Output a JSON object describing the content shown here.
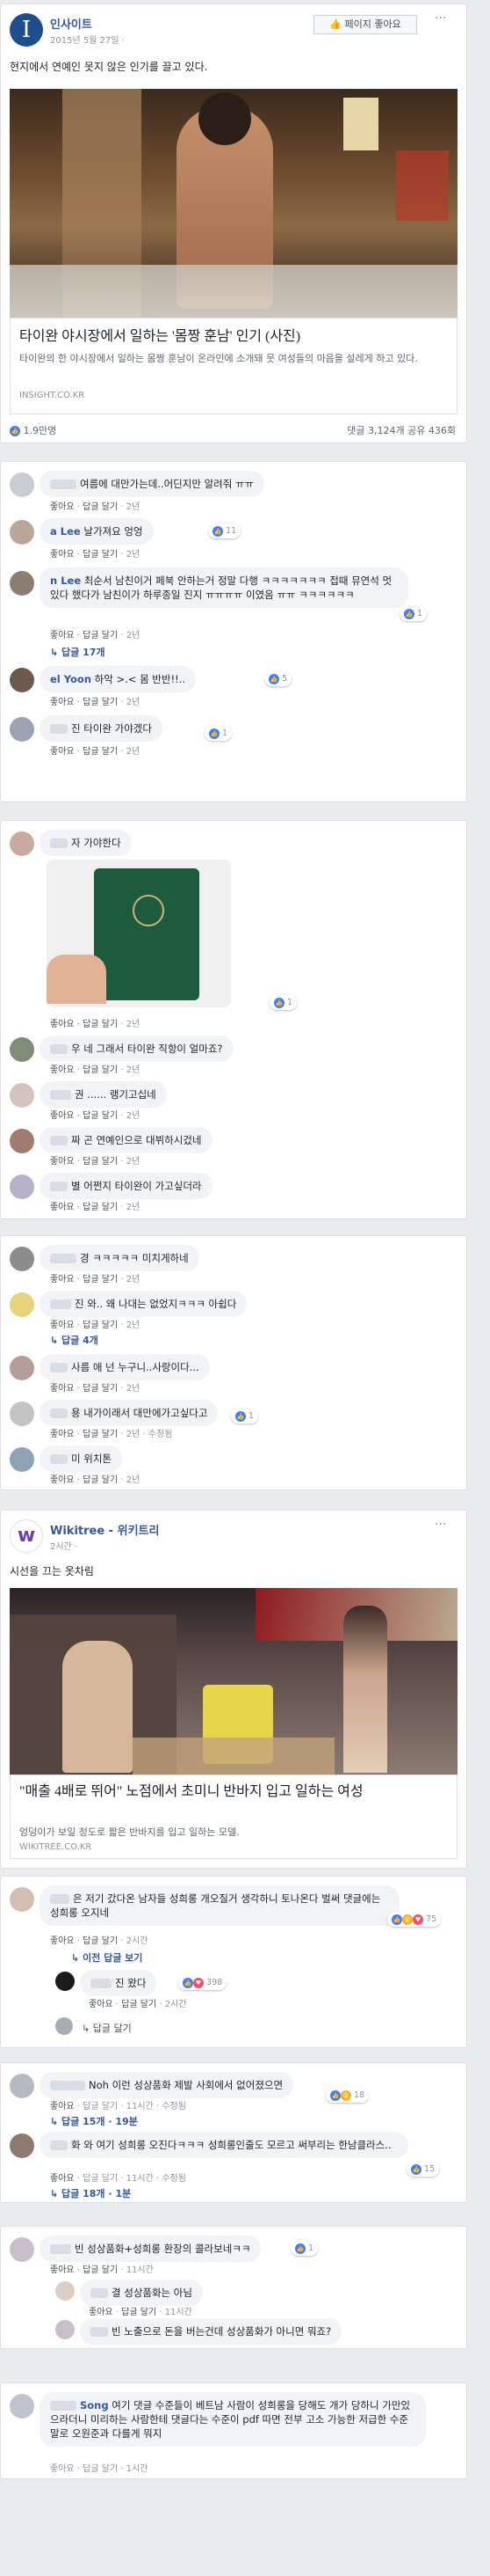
{
  "post1": {
    "page_name": "인사이트",
    "date": "2015년 5월 27일 ·",
    "like_page_button": "페이지 좋아요",
    "caption": "현지에서 연예인 못지 않은 인기를 끌고 있다.",
    "link_title": "타이완 야시장에서 일하는 '몸짱 훈남' 인기 (사진)",
    "link_desc": "타이완의 한 야시장에서 일하는 몸짱 훈남이 온라인에 소개돼 뭇 여성들의 마음을 설레게 하고 있다.",
    "link_domain": "INSIGHT.CO.KR",
    "reactions_count": "1.9만명",
    "comments_shares": "댓글 3,124개 공유 436회"
  },
  "thread1": [
    {
      "name": "",
      "text": "여름에 대만가는데..어딘지만 알려줘 ㅠㅠ",
      "reactions": ""
    },
    {
      "name": "a Lee",
      "text": "날가져요 엉엉",
      "reactions": "11"
    },
    {
      "name": "n Lee",
      "text": "최순서 남친이거 페북 안하는거 정말 다행 ㅋㅋㅋㅋㅋㅋㅋ 접때 뮤연석 멋있다 했다가 남친이가 하루종일 진지 ㅠㅠㅠㅠ 이였음 ㅠㅠ ㅋㅋㅋㅋㅋㅋ",
      "reactions": "1"
    },
    {
      "name": "el Yoon",
      "text": "하악 >.< 몸 반반!!..",
      "reactions": "5"
    },
    {
      "name": "",
      "text": "진 타이완 가야겠다",
      "reactions": "1"
    }
  ],
  "thread1_replies": "답글 17개",
  "thread2": {
    "top_text": "자 가야한다",
    "reactions_img": "1",
    "replies": [
      {
        "text": "우 네 그래서 타이완 직항이 얼마죠?"
      },
      {
        "text": "권 ...... 랭기고십네"
      },
      {
        "text": "짜 곤 연예인으로 대뷔하시겄네"
      },
      {
        "text": "별 어쩐지 타이완이 가고싶더라"
      }
    ]
  },
  "thread3": [
    {
      "text": "경 ㅋㅋㅋㅋㅋ 미치게하네"
    },
    {
      "text": "진 와.. 왜 나대는 없었지ㅋㅋㅋ 아쉽다"
    },
    {
      "text": "사름 애 넌 누구니..사랑이다..."
    },
    {
      "text": "용 내가이래서 대만에가고싶다고",
      "reactions": "1"
    },
    {
      "text": "미 위치톤"
    }
  ],
  "thread3_replies": "답글 4개",
  "post2": {
    "page_name": "Wikitree - 위키트리",
    "date": "2시간 ·",
    "caption": "시선을 끄는 옷차림",
    "link_title": "\"매출 4배로 뛰어\" 노점에서 초미니 반바지 입고 일하는 여성",
    "link_desc": "엉덩이가 보일 정도로 짧은 반바지를 입고 일하는 모델.",
    "link_domain": "WIKITREE.CO.KR"
  },
  "thread4": [
    {
      "text": "은 저기 갔다온 남자들 성희롱 개오질거 생각하니 토나온다 벌써 댓글에는 성희롱 오지네",
      "reactions": "75"
    },
    {
      "text": "진 왔다",
      "reactions": "398"
    }
  ],
  "thread4_more": "이전 답글 보기",
  "thread4_reply": "답글 달기",
  "thread5": [
    {
      "text": "Noh 이런 성상품화 제발 사회에서 없어졌으면",
      "reactions": "18",
      "meta_extra": "답글 달기 · 11시간 · 수정됨"
    },
    {
      "text": "화 와 여기 성희롱 오진다ㅋㅋㅋ 성희롱인줄도 모르고 써부리는 한남클라스..",
      "reactions": "15",
      "meta_extra": "답글 달기 · 11시간 · 수정됨"
    }
  ],
  "thread5_replies_a": "답글 15개 · 19분",
  "thread5_replies_b": "답글 18개 · 1분",
  "thread6": [
    {
      "text": "빈 성상품화+성희롱 환장의 콜라보네ㅋㅋ",
      "reactions": "1"
    },
    {
      "text": "결 성상품화는 아님"
    },
    {
      "text": "빈 노출으로 돈을 버는건데 성상품화가 아니면 뭐죠?"
    }
  ],
  "thread7": {
    "name": "Song",
    "text": "여기 댓글 수준들이 베트남 사람이 성희롱을 당해도 개가 당하니 가만있으라더니 미리하는 사람한테 댓글다는 수준이 pdf 따면 전부 고소 가능한 저급한 수준 말로 오원준과 다를게 뭐지",
    "meta": "좋아요 · 답글 달기 · 1시간"
  },
  "labels": {
    "like": "좋아요",
    "reply": "답글 달기",
    "time_2y": "2년",
    "time_11h": "11시간",
    "time_2h": "2시간",
    "edited": "수정됨"
  }
}
